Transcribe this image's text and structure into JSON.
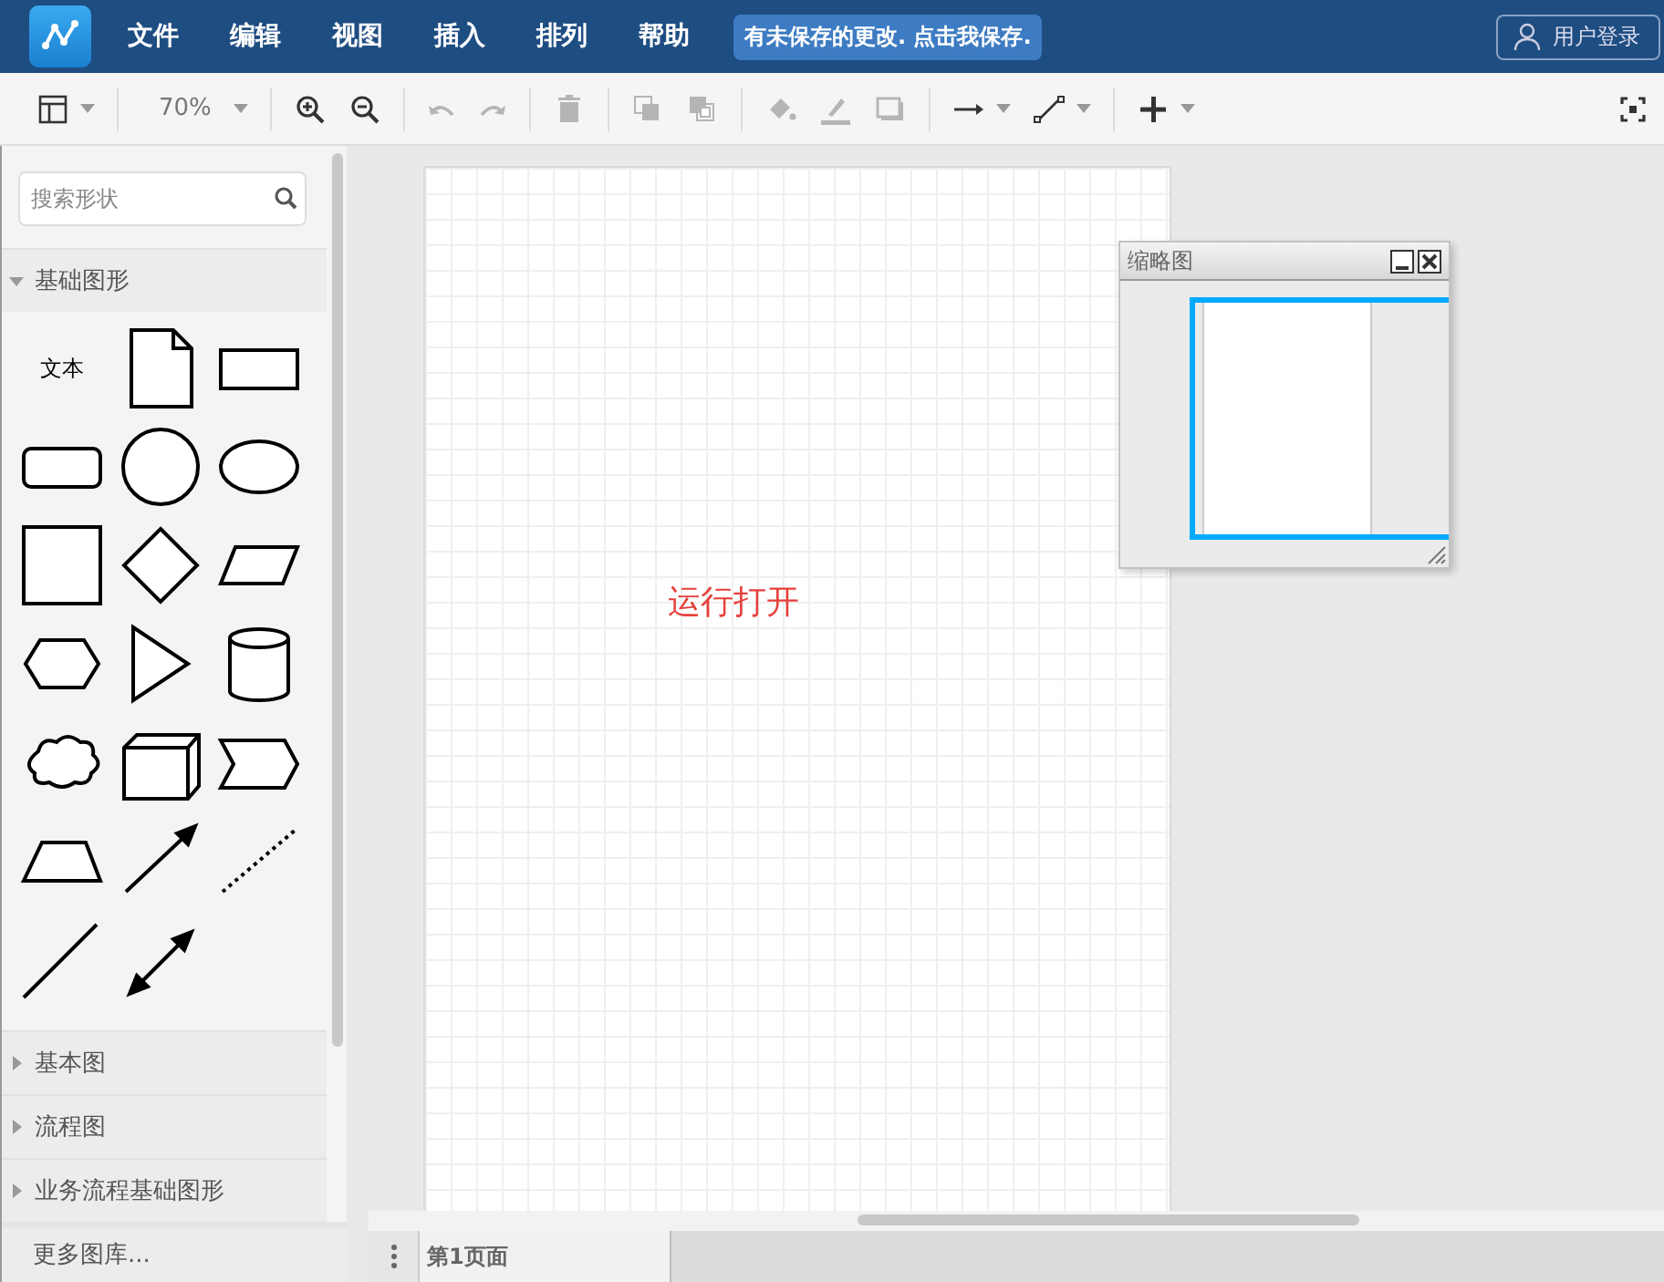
{
  "menu": [
    {
      "label": "文件"
    },
    {
      "label": "编辑"
    },
    {
      "label": "视图"
    },
    {
      "label": "插入"
    },
    {
      "label": "排列"
    },
    {
      "label": "帮助"
    }
  ],
  "save_notice": "有未保存的更改. 点击我保存.",
  "login": "用户登录",
  "toolbar": [
    [
      {
        "kind": "layout",
        "disabled": false,
        "dropdown": true
      }
    ],
    [
      {
        "kind": "zoom",
        "label": "70%",
        "disabled": false,
        "dropdown": true
      }
    ],
    [
      {
        "kind": "zoom-in",
        "disabled": false,
        "dropdown": false
      },
      {
        "kind": "zoom-out",
        "disabled": false,
        "dropdown": false
      }
    ],
    [
      {
        "kind": "undo",
        "disabled": true,
        "dropdown": false
      },
      {
        "kind": "redo",
        "disabled": true,
        "dropdown": false
      }
    ],
    [
      {
        "kind": "delete",
        "disabled": true,
        "dropdown": false
      }
    ],
    [
      {
        "kind": "to-front",
        "disabled": true,
        "dropdown": false
      },
      {
        "kind": "to-back",
        "disabled": true,
        "dropdown": false
      }
    ],
    [
      {
        "kind": "fill",
        "disabled": true,
        "dropdown": false
      },
      {
        "kind": "line-color",
        "disabled": true,
        "dropdown": false
      },
      {
        "kind": "shadow",
        "disabled": true,
        "dropdown": false
      }
    ],
    [
      {
        "kind": "connector",
        "disabled": false,
        "dropdown": true
      },
      {
        "kind": "waypoint",
        "disabled": false,
        "dropdown": true
      }
    ],
    [
      {
        "kind": "insert",
        "disabled": false,
        "dropdown": true
      }
    ]
  ],
  "search": {
    "placeholder": "搜索形状"
  },
  "sections": [
    {
      "title": "基础图形",
      "expanded": true
    },
    {
      "title": "基本图",
      "expanded": false
    },
    {
      "title": "流程图",
      "expanded": false
    },
    {
      "title": "业务流程基础图形",
      "expanded": false
    }
  ],
  "shapes": [
    {
      "kind": "text",
      "label": "文本"
    },
    {
      "kind": "note"
    },
    {
      "kind": "rect"
    },
    {
      "kind": "rounded"
    },
    {
      "kind": "circle"
    },
    {
      "kind": "ellipse"
    },
    {
      "kind": "square"
    },
    {
      "kind": "diamond"
    },
    {
      "kind": "parallelogram"
    },
    {
      "kind": "hexagon"
    },
    {
      "kind": "triangle"
    },
    {
      "kind": "cylinder"
    },
    {
      "kind": "cloud"
    },
    {
      "kind": "cube"
    },
    {
      "kind": "step"
    },
    {
      "kind": "trapezoid"
    },
    {
      "kind": "arrow"
    },
    {
      "kind": "dotted"
    },
    {
      "kind": "line"
    },
    {
      "kind": "double-arrow"
    }
  ],
  "more_libraries": "更多图库...",
  "canvas_text": "运行打开",
  "outline": {
    "title": "缩略图"
  },
  "pages": [
    {
      "label": "第1页面",
      "selected": true
    }
  ]
}
